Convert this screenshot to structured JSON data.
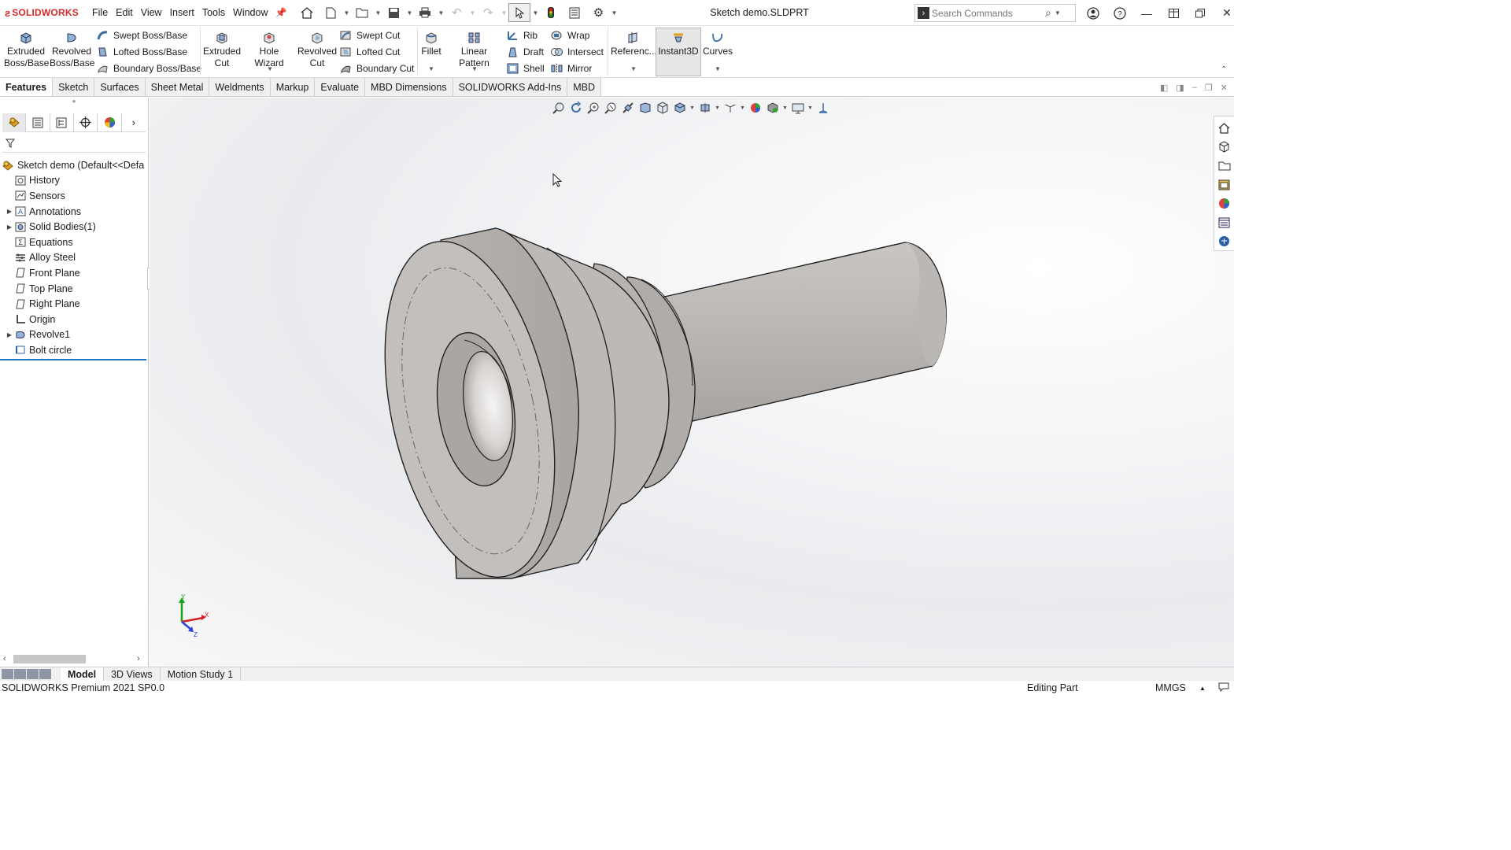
{
  "app": {
    "brand": "SOLIDWORKS",
    "document_title": "Sketch demo.SLDPRT"
  },
  "menu": [
    "File",
    "Edit",
    "View",
    "Insert",
    "Tools",
    "Window"
  ],
  "search": {
    "placeholder": "Search Commands"
  },
  "ribbon": {
    "extruded_boss": "Extruded Boss/Base",
    "revolved_boss": "Revolved Boss/Base",
    "swept_boss": "Swept Boss/Base",
    "lofted_boss": "Lofted Boss/Base",
    "boundary_boss": "Boundary Boss/Base",
    "extruded_cut": "Extruded Cut",
    "hole_wizard": "Hole Wizard",
    "revolved_cut": "Revolved Cut",
    "swept_cut": "Swept Cut",
    "lofted_cut": "Lofted Cut",
    "boundary_cut": "Boundary Cut",
    "fillet": "Fillet",
    "linear_pattern": "Linear Pattern",
    "rib": "Rib",
    "draft": "Draft",
    "shell": "Shell",
    "wrap": "Wrap",
    "intersect": "Intersect",
    "mirror": "Mirror",
    "reference": "Referenc...",
    "instant3d": "Instant3D",
    "curves": "Curves"
  },
  "command_tabs": [
    "Features",
    "Sketch",
    "Surfaces",
    "Sheet Metal",
    "Weldments",
    "Markup",
    "Evaluate",
    "MBD Dimensions",
    "SOLIDWORKS Add-Ins",
    "MBD"
  ],
  "feature_tree": {
    "root": "Sketch demo  (Default<<Defa",
    "items": [
      {
        "label": "History",
        "icon": "history-icon",
        "expandable": false
      },
      {
        "label": "Sensors",
        "icon": "sensors-icon",
        "expandable": false
      },
      {
        "label": "Annotations",
        "icon": "annotations-icon",
        "expandable": true
      },
      {
        "label": "Solid Bodies(1)",
        "icon": "solid-bodies-icon",
        "expandable": true
      },
      {
        "label": "Equations",
        "icon": "equations-icon",
        "expandable": false
      },
      {
        "label": "Alloy Steel",
        "icon": "material-icon",
        "expandable": false
      },
      {
        "label": "Front Plane",
        "icon": "plane-icon",
        "expandable": false
      },
      {
        "label": "Top Plane",
        "icon": "plane-icon",
        "expandable": false
      },
      {
        "label": "Right Plane",
        "icon": "plane-icon",
        "expandable": false
      },
      {
        "label": "Origin",
        "icon": "origin-icon",
        "expandable": false
      },
      {
        "label": "Revolve1",
        "icon": "revolve-icon",
        "expandable": true
      },
      {
        "label": "Bolt circle",
        "icon": "sketch-icon",
        "expandable": false
      }
    ]
  },
  "triad": {
    "x": "X",
    "y": "Y",
    "z": "Z"
  },
  "bottom_tabs": [
    "Model",
    "3D Views",
    "Motion Study 1"
  ],
  "status": {
    "product": "SOLIDWORKS Premium 2021 SP0.0",
    "mode": "Editing Part",
    "units": "MMGS"
  },
  "colors": {
    "brand": "#d32b2b",
    "accent": "#1a76c6",
    "model_face": "#bdbab7"
  }
}
